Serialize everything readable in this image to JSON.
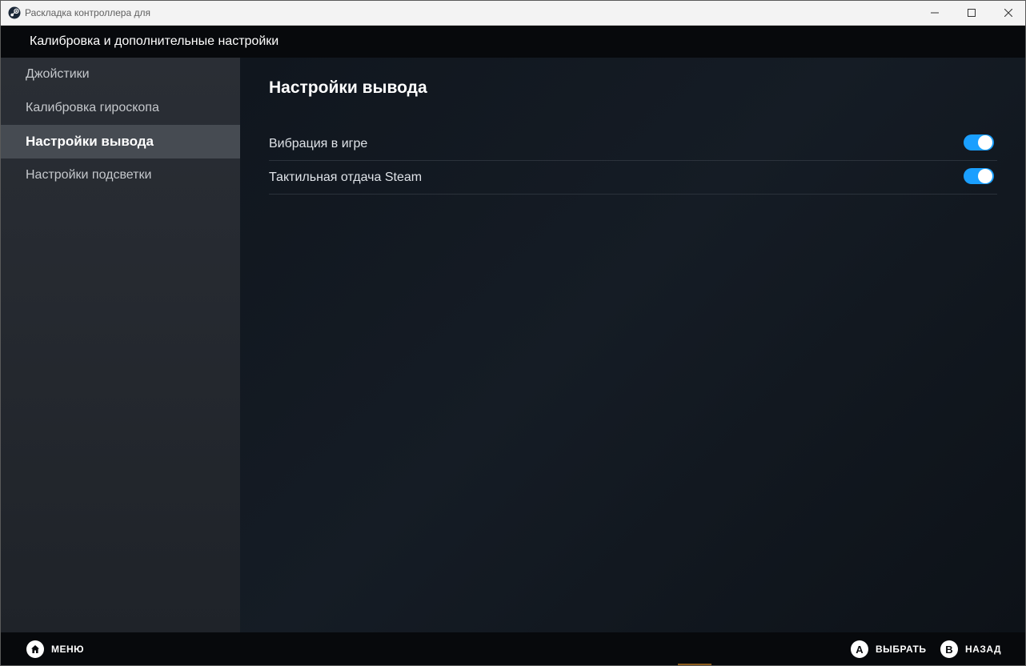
{
  "window": {
    "title": "Раскладка контроллера для",
    "app_icon": "steam-icon",
    "controls": [
      "minimize-icon",
      "maximize-icon",
      "close-icon"
    ]
  },
  "header": {
    "title": "Калибровка и дополнительные настройки"
  },
  "sidebar": {
    "items": [
      {
        "label": "Джойстики",
        "active": false
      },
      {
        "label": "Калибровка гироскопа",
        "active": false
      },
      {
        "label": "Настройки вывода",
        "active": true
      },
      {
        "label": "Настройки подсветки",
        "active": false
      }
    ]
  },
  "main": {
    "title": "Настройки вывода",
    "settings": [
      {
        "label": "Вибрация в игре",
        "enabled": true
      },
      {
        "label": "Тактильная отдача Steam",
        "enabled": true
      }
    ]
  },
  "footer": {
    "menu": {
      "glyph": "home-icon",
      "label": "МЕНЮ"
    },
    "select": {
      "glyph": "A",
      "label": "ВЫБРАТЬ"
    },
    "back": {
      "glyph": "B",
      "label": "НАЗАД"
    }
  },
  "colors": {
    "accent": "#1a9fff",
    "sidebar_active": "#464b52",
    "background": "#0e141b"
  }
}
